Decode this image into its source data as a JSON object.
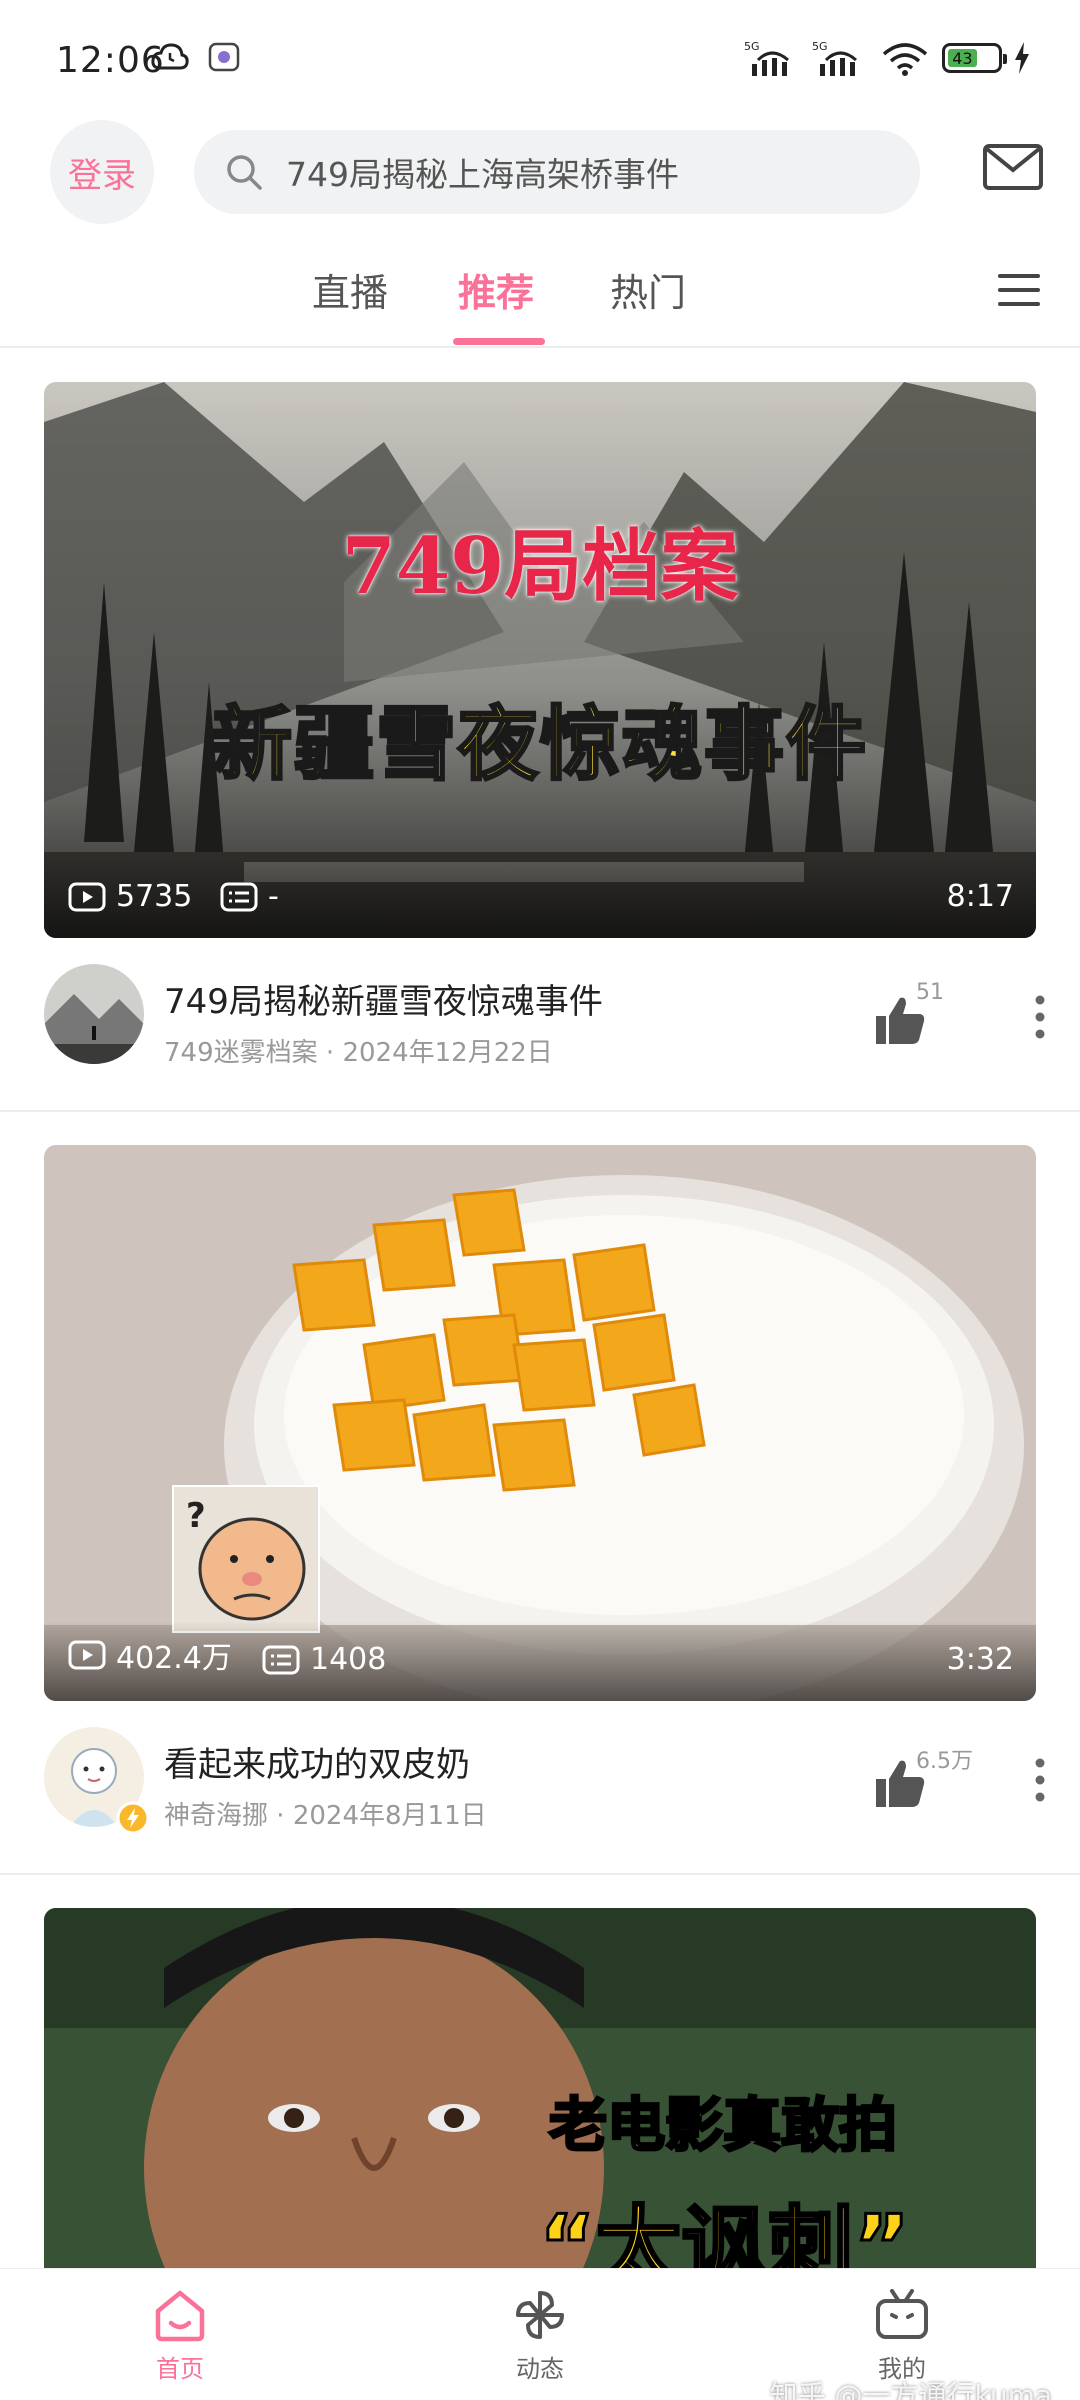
{
  "status_bar": {
    "time": "12:06",
    "battery_level": "43"
  },
  "header": {
    "login_label": "登录",
    "search_placeholder": "749局揭秘上海高架桥事件"
  },
  "tabs": [
    {
      "label": "直播"
    },
    {
      "label": "推荐"
    },
    {
      "label": "热门"
    }
  ],
  "feed": [
    {
      "thumb_title_red": "749局档案",
      "thumb_title_yellow": "新疆雪夜惊魂事件",
      "plays": "5735",
      "danmaku": "-",
      "duration": "8:17",
      "title": "749局揭秘新疆雪夜惊魂事件",
      "author": "749迷雾档案",
      "date": "2024年12月22日",
      "likes": "51"
    },
    {
      "plays": "402.4万",
      "danmaku": "1408",
      "duration": "3:32",
      "title": "看起来成功的双皮奶",
      "author": "神奇海挪",
      "date": "2024年8月11日",
      "likes": "6.5万"
    },
    {
      "thumb_title_white": "老电影真敢拍",
      "thumb_title_quote": "“太讽刺”"
    }
  ],
  "bottom_nav": [
    {
      "label": "首页",
      "icon": "home-icon"
    },
    {
      "label": "动态",
      "icon": "pinwheel-icon"
    },
    {
      "label": "我的",
      "icon": "tv-icon"
    }
  ],
  "watermark": "知乎 @一方通行kuma",
  "colors": {
    "accent": "#fb7299",
    "text_primary": "#222222",
    "text_secondary": "#999999"
  }
}
